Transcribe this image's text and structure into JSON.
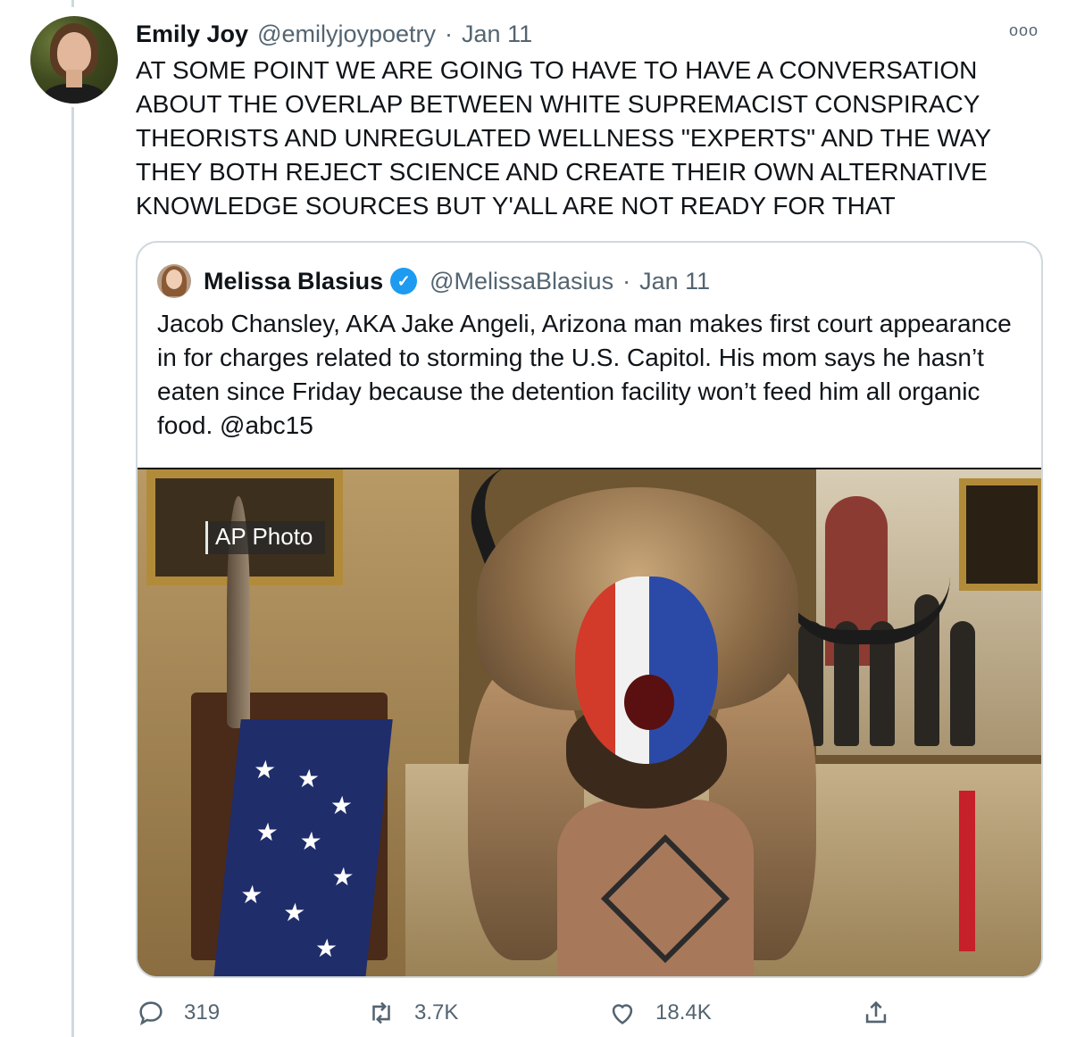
{
  "tweet": {
    "author_name": "Emily Joy",
    "handle": "@emilyjoypoetry",
    "separator": "·",
    "date": "Jan 11",
    "more_icon": "ooo",
    "text": "AT SOME POINT WE ARE GOING TO HAVE TO HAVE A CONVERSATION ABOUT THE OVERLAP BETWEEN WHITE SUPREMACIST CONSPIRACY THEORISTS AND UNREGULATED WELLNESS \"EXPERTS\" AND THE WAY THEY BOTH REJECT SCIENCE AND CREATE THEIR OWN ALTERNATIVE KNOWLEDGE SOURCES BUT Y'ALL ARE NOT READY FOR THAT"
  },
  "quote": {
    "author_name": "Melissa Blasius",
    "verified_icon": "verified-check-icon",
    "handle": "@MelissaBlasius",
    "separator": "·",
    "date": "Jan 11",
    "text": "Jacob Chansley, AKA Jake Angeli, Arizona man makes first court appearance in for charges related to storming the U.S. Capitol. His mom says he hasn’t eaten since Friday because the detention facility won’t feed him all organic food. @abc15",
    "photo_watermark": "AP Photo"
  },
  "actions": {
    "reply_count": "319",
    "retweet_count": "3.7K",
    "like_count": "18.4K"
  },
  "colors": {
    "muted": "#536471",
    "border": "#cfd9de",
    "verified": "#1d9bf0"
  }
}
